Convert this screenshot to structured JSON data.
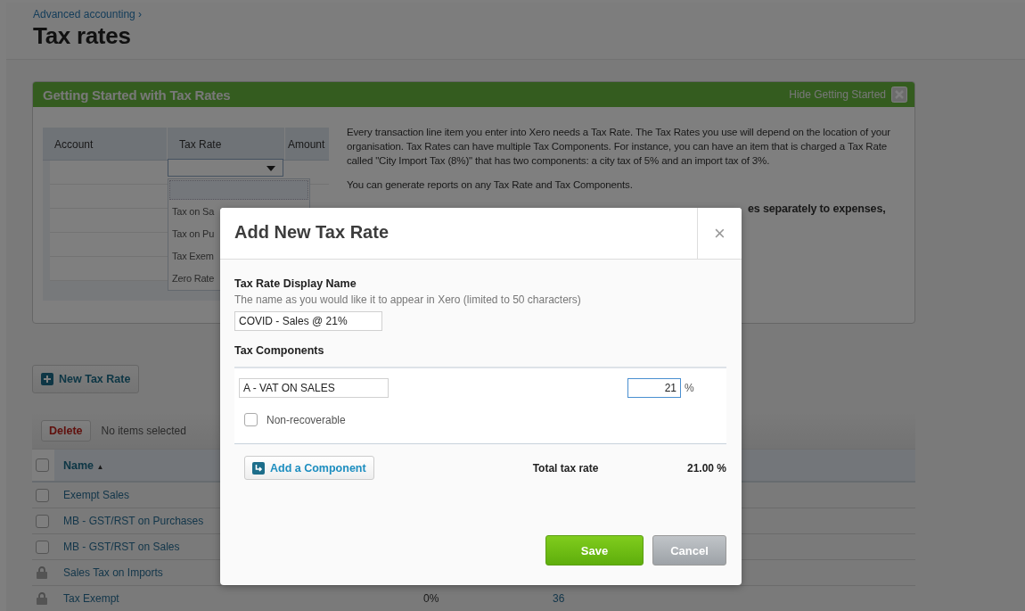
{
  "breadcrumb": "Advanced accounting ›",
  "title": "Tax rates",
  "getting_started": {
    "title": "Getting Started with Tax Rates",
    "hide_label": "Hide Getting Started",
    "sample_table": {
      "columns": [
        "Account",
        "Tax Rate",
        "Amount"
      ],
      "dropdown_items": [
        "Tax on Sa",
        "Tax on Pu",
        "Tax Exem",
        "Zero Rate"
      ]
    },
    "paragraphs": [
      "Every transaction line item you enter into Xero needs a Tax Rate. The Tax Rates you use will depend on the location of your organisation. Tax Rates can have multiple Tax Components. For instance, you can have an item that is charged a Tax Rate called \"City Import Tax (8%)\" that has two components: a city tax of 5% and an import tax of 3%.",
      "You can generate reports on any Tax Rate and Tax Components."
    ],
    "partial_bold": "es separately to expenses,"
  },
  "new_button": "New Tax Rate",
  "list": {
    "delete_label": "Delete",
    "selection_status": "No items selected",
    "select_all_checked": false,
    "name_header": "Name",
    "sort_indicator": "▲",
    "rows": [
      {
        "kind": "checkbox",
        "checked": false,
        "name": "Exempt Sales"
      },
      {
        "kind": "checkbox",
        "checked": false,
        "name": "MB - GST/RST on Purchases"
      },
      {
        "kind": "checkbox",
        "checked": false,
        "name": "MB - GST/RST on Sales"
      },
      {
        "kind": "locked",
        "name": "Sales Tax on Imports"
      },
      {
        "kind": "locked",
        "name": "Tax Exempt",
        "rate": "0%",
        "count": "36"
      }
    ]
  },
  "modal": {
    "title": "Add New Tax Rate",
    "close": "×",
    "display_name": {
      "label": "Tax Rate Display Name",
      "hint": "The name as you would like it to appear in Xero (limited to 50 characters)",
      "value": "COVID - Sales @ 21%"
    },
    "components_label": "Tax Components",
    "components": [
      {
        "account": "A - VAT ON SALES",
        "rate": "21",
        "focused": true,
        "percent_sign": "%",
        "non_recoverable_label": "Non-recoverable",
        "non_recoverable": false
      }
    ],
    "add_component": "Add a Component",
    "total_label": "Total tax rate",
    "total_value": "21.00 %",
    "buttons": [
      {
        "kind": "primary",
        "label": "Save"
      },
      {
        "kind": "secondary",
        "label": "Cancel"
      }
    ]
  }
}
